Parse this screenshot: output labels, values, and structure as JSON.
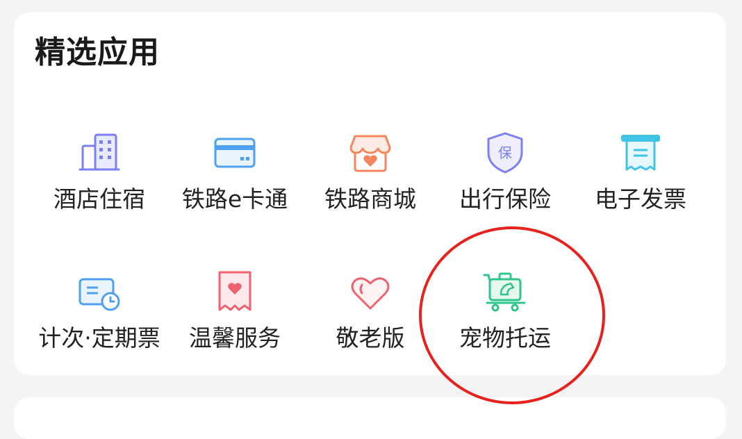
{
  "section": {
    "title": "精选应用"
  },
  "apps": [
    {
      "label": "酒店住宿",
      "icon": "hotel-building-icon",
      "color": "#7b7ff5"
    },
    {
      "label": "铁路e卡通",
      "icon": "bank-card-icon",
      "color": "#4ea1f0"
    },
    {
      "label": "铁路商城",
      "icon": "shop-storefront-icon",
      "color": "#f5845f"
    },
    {
      "label": "出行保险",
      "icon": "insurance-shield-icon",
      "color": "#7b7ff5"
    },
    {
      "label": "电子发票",
      "icon": "invoice-receipt-icon",
      "color": "#3fc4e6"
    },
    {
      "label": "计次·定期票",
      "icon": "ticket-clock-icon",
      "color": "#4ea1f0"
    },
    {
      "label": "温馨服务",
      "icon": "heart-bookmark-icon",
      "color": "#f0616e"
    },
    {
      "label": "敬老版",
      "icon": "heart-outline-icon",
      "color": "#f0616e"
    },
    {
      "label": "宠物托运",
      "icon": "pet-cart-icon",
      "color": "#2ec58a"
    }
  ],
  "highlight": {
    "target": "宠物托运",
    "color": "#e8211c"
  }
}
